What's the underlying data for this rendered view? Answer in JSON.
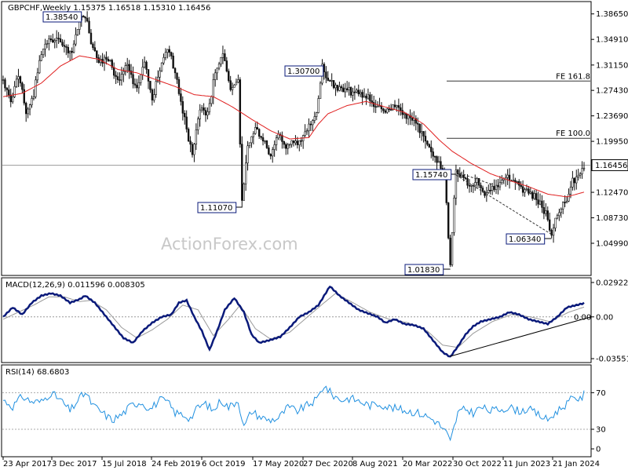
{
  "chart_data": {
    "type": "candlestick",
    "symbol": "GBPCHF,Weekly",
    "ohlc_header": "1.15375 1.16518 1.15310 1.16456",
    "last_price": "1.16456",
    "watermark": "ActionForex.com",
    "price_axis": {
      "ylim": [
        1.005,
        1.4
      ],
      "ticks": [
        "1.38650",
        "1.34910",
        "1.31150",
        "1.27430",
        "1.23690",
        "1.19950",
        "1.12470",
        "1.08730",
        "1.04990"
      ]
    },
    "x_tick_labels": [
      "23 Apr 2017",
      "3 Dec 2017",
      "15 Jul 2018",
      "24 Feb 2019",
      "6 Oct 2019",
      "17 May 2020",
      "27 Dec 2020",
      "8 Aug 2021",
      "20 Mar 2022",
      "30 Oct 2022",
      "11 Jun 2023",
      "21 Jan 2024"
    ],
    "price_series_anchors": [
      [
        0,
        1.29
      ],
      [
        4,
        1.26
      ],
      [
        8,
        1.3
      ],
      [
        12,
        1.24
      ],
      [
        16,
        1.27
      ],
      [
        20,
        1.33
      ],
      [
        24,
        1.35
      ],
      [
        30,
        1.345
      ],
      [
        36,
        1.33
      ],
      [
        40,
        1.375
      ],
      [
        43,
        1.3854
      ],
      [
        46,
        1.345
      ],
      [
        50,
        1.32
      ],
      [
        55,
        1.32
      ],
      [
        60,
        1.29
      ],
      [
        65,
        1.31
      ],
      [
        70,
        1.275
      ],
      [
        74,
        1.32
      ],
      [
        78,
        1.26
      ],
      [
        82,
        1.305
      ],
      [
        86,
        1.34
      ],
      [
        90,
        1.3
      ],
      [
        95,
        1.23
      ],
      [
        99,
        1.18
      ],
      [
        103,
        1.25
      ],
      [
        107,
        1.24
      ],
      [
        111,
        1.3
      ],
      [
        115,
        1.33
      ],
      [
        119,
        1.275
      ],
      [
        123,
        1.29
      ],
      [
        125,
        1.1107
      ],
      [
        128,
        1.19
      ],
      [
        132,
        1.22
      ],
      [
        136,
        1.2
      ],
      [
        140,
        1.18
      ],
      [
        144,
        1.21
      ],
      [
        148,
        1.19
      ],
      [
        152,
        1.2
      ],
      [
        156,
        1.2
      ],
      [
        160,
        1.22
      ],
      [
        164,
        1.24
      ],
      [
        167,
        1.307
      ],
      [
        170,
        1.29
      ],
      [
        175,
        1.28
      ],
      [
        180,
        1.275
      ],
      [
        185,
        1.27
      ],
      [
        190,
        1.265
      ],
      [
        195,
        1.25
      ],
      [
        200,
        1.245
      ],
      [
        205,
        1.255
      ],
      [
        210,
        1.24
      ],
      [
        215,
        1.23
      ],
      [
        220,
        1.21
      ],
      [
        224,
        1.18
      ],
      [
        228,
        1.17
      ],
      [
        231,
        1.15
      ],
      [
        234,
        1.0183
      ],
      [
        237,
        1.1574
      ],
      [
        240,
        1.15
      ],
      [
        244,
        1.13
      ],
      [
        248,
        1.14
      ],
      [
        252,
        1.12
      ],
      [
        256,
        1.13
      ],
      [
        260,
        1.14
      ],
      [
        264,
        1.15
      ],
      [
        268,
        1.14
      ],
      [
        272,
        1.13
      ],
      [
        276,
        1.125
      ],
      [
        280,
        1.11
      ],
      [
        284,
        1.095
      ],
      [
        287,
        1.0634
      ],
      [
        290,
        1.09
      ],
      [
        294,
        1.11
      ],
      [
        298,
        1.14
      ],
      [
        302,
        1.155
      ],
      [
        304,
        1.16456
      ]
    ],
    "moving_average_anchors": [
      [
        0,
        1.265
      ],
      [
        10,
        1.27
      ],
      [
        20,
        1.285
      ],
      [
        30,
        1.31
      ],
      [
        40,
        1.325
      ],
      [
        50,
        1.32
      ],
      [
        60,
        1.305
      ],
      [
        70,
        1.3
      ],
      [
        80,
        1.29
      ],
      [
        90,
        1.28
      ],
      [
        100,
        1.268
      ],
      [
        110,
        1.265
      ],
      [
        120,
        1.25
      ],
      [
        130,
        1.232
      ],
      [
        140,
        1.215
      ],
      [
        150,
        1.203
      ],
      [
        160,
        1.205
      ],
      [
        165,
        1.225
      ],
      [
        170,
        1.24
      ],
      [
        180,
        1.252
      ],
      [
        190,
        1.258
      ],
      [
        200,
        1.25
      ],
      [
        210,
        1.242
      ],
      [
        220,
        1.225
      ],
      [
        228,
        1.202
      ],
      [
        235,
        1.185
      ],
      [
        245,
        1.167
      ],
      [
        255,
        1.152
      ],
      [
        265,
        1.142
      ],
      [
        275,
        1.133
      ],
      [
        285,
        1.122
      ],
      [
        295,
        1.118
      ],
      [
        304,
        1.125
      ]
    ],
    "price_labels": [
      "1.38540",
      "1.11070",
      "1.30700",
      "1.15740",
      "1.06340",
      "1.01830"
    ],
    "fib_levels": [
      {
        "label": "FE 161.8",
        "value": 1.288
      },
      {
        "label": "FE 100.0",
        "value": 1.204
      }
    ],
    "horizontal_line": 1.16456,
    "macd": {
      "label": "MACD(12,26,9) 0.011596 0.008305",
      "ticks": [
        "0.029221",
        "0.00",
        "-0.035518"
      ],
      "right_value": "0.00",
      "anchors": [
        [
          0,
          0.0
        ],
        [
          5,
          0.008
        ],
        [
          10,
          0.002
        ],
        [
          15,
          0.012
        ],
        [
          20,
          0.018
        ],
        [
          25,
          0.02
        ],
        [
          30,
          0.018
        ],
        [
          35,
          0.012
        ],
        [
          40,
          0.015
        ],
        [
          43,
          0.018
        ],
        [
          48,
          0.012
        ],
        [
          53,
          0.002
        ],
        [
          58,
          -0.008
        ],
        [
          63,
          -0.018
        ],
        [
          68,
          -0.022
        ],
        [
          73,
          -0.012
        ],
        [
          78,
          -0.005
        ],
        [
          83,
          0.0
        ],
        [
          88,
          0.002
        ],
        [
          92,
          0.012
        ],
        [
          96,
          0.014
        ],
        [
          100,
          0.0
        ],
        [
          104,
          -0.012
        ],
        [
          108,
          -0.028
        ],
        [
          112,
          -0.012
        ],
        [
          116,
          0.006
        ],
        [
          121,
          0.016
        ],
        [
          126,
          0.004
        ],
        [
          130,
          -0.015
        ],
        [
          134,
          -0.022
        ],
        [
          139,
          -0.02
        ],
        [
          145,
          -0.017
        ],
        [
          150,
          -0.009
        ],
        [
          155,
          0.0
        ],
        [
          160,
          0.004
        ],
        [
          165,
          0.01
        ],
        [
          171,
          0.026
        ],
        [
          176,
          0.018
        ],
        [
          181,
          0.012
        ],
        [
          186,
          0.006
        ],
        [
          191,
          0.003
        ],
        [
          196,
          0.0
        ],
        [
          200,
          -0.005
        ],
        [
          205,
          -0.002
        ],
        [
          210,
          -0.006
        ],
        [
          215,
          -0.007
        ],
        [
          220,
          -0.01
        ],
        [
          225,
          -0.02
        ],
        [
          230,
          -0.03
        ],
        [
          234,
          -0.034
        ],
        [
          238,
          -0.025
        ],
        [
          242,
          -0.015
        ],
        [
          246,
          -0.008
        ],
        [
          250,
          -0.004
        ],
        [
          255,
          -0.002
        ],
        [
          260,
          0.0
        ],
        [
          265,
          0.004
        ],
        [
          270,
          0.002
        ],
        [
          275,
          -0.002
        ],
        [
          280,
          -0.004
        ],
        [
          285,
          -0.006
        ],
        [
          290,
          0.0
        ],
        [
          295,
          0.008
        ],
        [
          300,
          0.01
        ],
        [
          304,
          0.0116
        ]
      ],
      "signal_anchors": [
        [
          0,
          -0.002
        ],
        [
          8,
          0.004
        ],
        [
          16,
          0.01
        ],
        [
          24,
          0.017
        ],
        [
          32,
          0.017
        ],
        [
          40,
          0.013
        ],
        [
          46,
          0.014
        ],
        [
          54,
          0.006
        ],
        [
          62,
          -0.009
        ],
        [
          70,
          -0.018
        ],
        [
          78,
          -0.011
        ],
        [
          86,
          -0.002
        ],
        [
          94,
          0.01
        ],
        [
          102,
          0.006
        ],
        [
          110,
          -0.016
        ],
        [
          118,
          -0.002
        ],
        [
          124,
          0.01
        ],
        [
          132,
          -0.01
        ],
        [
          140,
          -0.019
        ],
        [
          150,
          -0.013
        ],
        [
          160,
          0.001
        ],
        [
          168,
          0.012
        ],
        [
          174,
          0.02
        ],
        [
          182,
          0.013
        ],
        [
          192,
          0.004
        ],
        [
          202,
          -0.002
        ],
        [
          212,
          -0.005
        ],
        [
          222,
          -0.012
        ],
        [
          230,
          -0.024
        ],
        [
          238,
          -0.026
        ],
        [
          246,
          -0.014
        ],
        [
          256,
          -0.004
        ],
        [
          266,
          0.002
        ],
        [
          276,
          0.0
        ],
        [
          286,
          -0.004
        ],
        [
          296,
          0.004
        ],
        [
          304,
          0.0083
        ]
      ]
    },
    "rsi": {
      "label": "RSI(14) 68.6803",
      "ticks": [
        "70",
        "30",
        "0"
      ],
      "anchors": [
        [
          0,
          62
        ],
        [
          5,
          55
        ],
        [
          10,
          66
        ],
        [
          15,
          60
        ],
        [
          20,
          60
        ],
        [
          25,
          70
        ],
        [
          30,
          62
        ],
        [
          35,
          50
        ],
        [
          40,
          64
        ],
        [
          43,
          70
        ],
        [
          47,
          56
        ],
        [
          52,
          48
        ],
        [
          57,
          40
        ],
        [
          62,
          46
        ],
        [
          67,
          56
        ],
        [
          72,
          60
        ],
        [
          77,
          52
        ],
        [
          82,
          62
        ],
        [
          86,
          60
        ],
        [
          90,
          48
        ],
        [
          94,
          46
        ],
        [
          98,
          42
        ],
        [
          102,
          54
        ],
        [
          106,
          58
        ],
        [
          110,
          50
        ],
        [
          114,
          62
        ],
        [
          118,
          54
        ],
        [
          123,
          62
        ],
        [
          126,
          32
        ],
        [
          130,
          50
        ],
        [
          134,
          44
        ],
        [
          139,
          40
        ],
        [
          144,
          42
        ],
        [
          149,
          54
        ],
        [
          154,
          50
        ],
        [
          159,
          56
        ],
        [
          164,
          62
        ],
        [
          168,
          78
        ],
        [
          172,
          68
        ],
        [
          177,
          62
        ],
        [
          182,
          64
        ],
        [
          187,
          60
        ],
        [
          192,
          56
        ],
        [
          197,
          58
        ],
        [
          202,
          54
        ],
        [
          207,
          52
        ],
        [
          212,
          50
        ],
        [
          217,
          48
        ],
        [
          222,
          44
        ],
        [
          227,
          38
        ],
        [
          232,
          26
        ],
        [
          234,
          16
        ],
        [
          238,
          48
        ],
        [
          242,
          52
        ],
        [
          246,
          48
        ],
        [
          250,
          54
        ],
        [
          255,
          50
        ],
        [
          260,
          52
        ],
        [
          265,
          54
        ],
        [
          270,
          50
        ],
        [
          275,
          52
        ],
        [
          280,
          46
        ],
        [
          285,
          40
        ],
        [
          290,
          50
        ],
        [
          295,
          58
        ],
        [
          299,
          66
        ],
        [
          302,
          62
        ],
        [
          304,
          68.68
        ]
      ]
    }
  }
}
